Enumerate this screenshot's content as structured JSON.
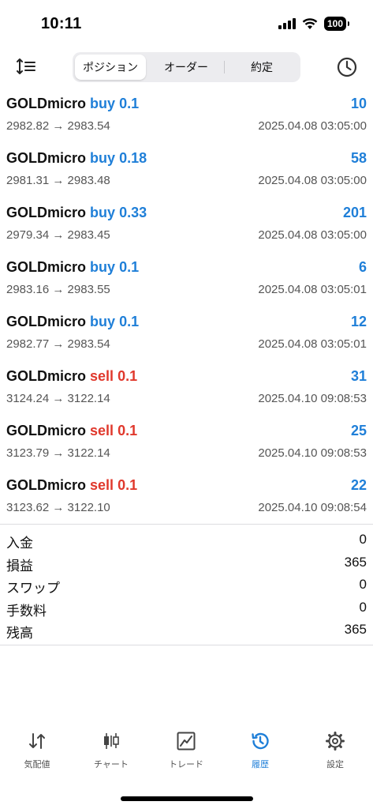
{
  "status_bar": {
    "time": "10:11",
    "battery": "100"
  },
  "tabs": [
    {
      "label": "ポジション",
      "active": true
    },
    {
      "label": "オーダー",
      "active": false
    },
    {
      "label": "約定",
      "active": false
    }
  ],
  "trades": [
    {
      "symbol": "GOLDmicro",
      "direction": "buy",
      "lots": "0.1",
      "profit": "10",
      "prices": "2982.82 → 2983.54",
      "time": "2025.04.08 03:05:00"
    },
    {
      "symbol": "GOLDmicro",
      "direction": "buy",
      "lots": "0.18",
      "profit": "58",
      "prices": "2981.31 → 2983.48",
      "time": "2025.04.08 03:05:00"
    },
    {
      "symbol": "GOLDmicro",
      "direction": "buy",
      "lots": "0.33",
      "profit": "201",
      "prices": "2979.34 → 2983.45",
      "time": "2025.04.08 03:05:00"
    },
    {
      "symbol": "GOLDmicro",
      "direction": "buy",
      "lots": "0.1",
      "profit": "6",
      "prices": "2983.16 → 2983.55",
      "time": "2025.04.08 03:05:01"
    },
    {
      "symbol": "GOLDmicro",
      "direction": "buy",
      "lots": "0.1",
      "profit": "12",
      "prices": "2982.77 → 2983.54",
      "time": "2025.04.08 03:05:01"
    },
    {
      "symbol": "GOLDmicro",
      "direction": "sell",
      "lots": "0.1",
      "profit": "31",
      "prices": "3124.24 → 3122.14",
      "time": "2025.04.10 09:08:53"
    },
    {
      "symbol": "GOLDmicro",
      "direction": "sell",
      "lots": "0.1",
      "profit": "25",
      "prices": "3123.79 → 3122.14",
      "time": "2025.04.10 09:08:53"
    },
    {
      "symbol": "GOLDmicro",
      "direction": "sell",
      "lots": "0.1",
      "profit": "22",
      "prices": "3123.62 → 3122.10",
      "time": "2025.04.10 09:08:54"
    }
  ],
  "summary": [
    {
      "label": "入金",
      "value": "0"
    },
    {
      "label": "損益",
      "value": "365"
    },
    {
      "label": "スワップ",
      "value": "0"
    },
    {
      "label": "手数料",
      "value": "0"
    },
    {
      "label": "残高",
      "value": "365"
    }
  ],
  "bottom_nav": [
    {
      "label": "気配値",
      "icon": "quotes-arrows-icon",
      "active": false
    },
    {
      "label": "チャート",
      "icon": "candlestick-chart-icon",
      "active": false
    },
    {
      "label": "トレード",
      "icon": "trade-chart-icon",
      "active": false
    },
    {
      "label": "履歴",
      "icon": "history-clock-icon",
      "active": true
    },
    {
      "label": "設定",
      "icon": "settings-gear-icon",
      "active": false
    }
  ],
  "colors": {
    "accent": "#1f7fd8",
    "sell": "#e0382c",
    "text": "#111111",
    "muted": "#555555"
  }
}
